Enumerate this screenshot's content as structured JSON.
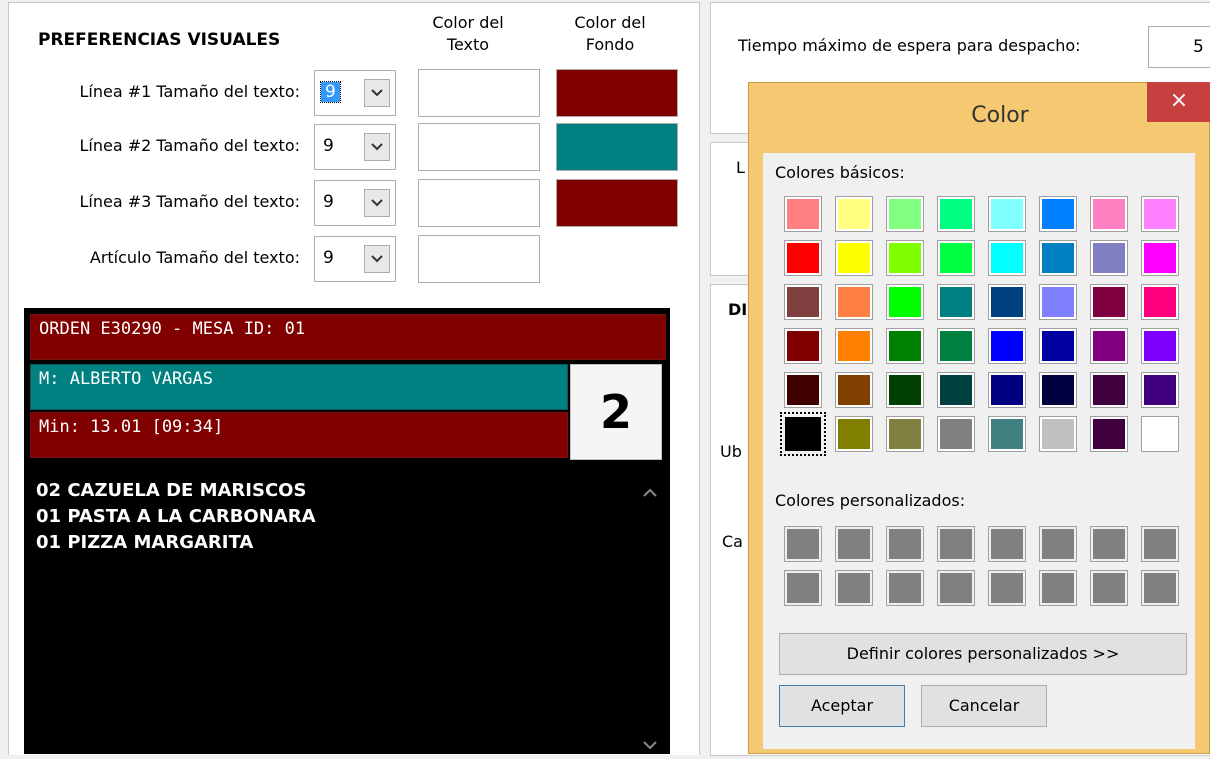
{
  "visual_prefs": {
    "title": "PREFERENCIAS VISUALES",
    "col_text_color": [
      "Color del",
      "Texto"
    ],
    "col_bg_color": [
      "Color del",
      "Fondo"
    ],
    "rows": [
      {
        "label": "Línea #1 Tamaño del texto:",
        "size": "9",
        "text_color": "#ffffff",
        "bg_color": "#800000"
      },
      {
        "label": "Línea #2 Tamaño del texto:",
        "size": "9",
        "text_color": "#ffffff",
        "bg_color": "#008080"
      },
      {
        "label": "Línea #3 Tamaño del texto:",
        "size": "9",
        "text_color": "#ffffff",
        "bg_color": "#800000"
      },
      {
        "label": "Artículo Tamaño del texto:",
        "size": "9",
        "text_color": "#ffffff",
        "bg_color": null
      }
    ]
  },
  "preview": {
    "line1": "ORDEN E30290 - MESA ID: 01",
    "line2": "M: ALBERTO VARGAS",
    "line3": "Min: 13.01 [09:34]",
    "number": "2",
    "items": [
      "02 CAZUELA DE MARISCOS",
      "01 PASTA A LA CARBONARA",
      "01 PIZZA MARGARITA"
    ]
  },
  "right": {
    "max_wait_label": "Tiempo máximo de espera para despacho:",
    "max_wait_value": "5",
    "partial_labels": [
      "L",
      "DI",
      "Ub",
      "Ca"
    ]
  },
  "color_dialog": {
    "title": "Color",
    "close": "×",
    "basic_label": "Colores básicos:",
    "custom_label": "Colores personalizados:",
    "define_button": "Definir colores personalizados >>",
    "ok_button": "Aceptar",
    "cancel_button": "Cancelar",
    "basic_colors": [
      [
        "#ff8080",
        "#ffff80",
        "#80ff80",
        "#00ff80",
        "#80ffff",
        "#0080ff",
        "#ff80c0",
        "#ff80ff"
      ],
      [
        "#ff0000",
        "#ffff00",
        "#80ff00",
        "#00ff40",
        "#00ffff",
        "#0080c0",
        "#8080c0",
        "#ff00ff"
      ],
      [
        "#804040",
        "#ff8040",
        "#00ff00",
        "#008080",
        "#004080",
        "#8080ff",
        "#800040",
        "#ff0080"
      ],
      [
        "#800000",
        "#ff8000",
        "#008000",
        "#008040",
        "#0000ff",
        "#0000a0",
        "#800080",
        "#8000ff"
      ],
      [
        "#400000",
        "#804000",
        "#004000",
        "#004040",
        "#000080",
        "#000040",
        "#400040",
        "#400080"
      ],
      [
        "#000000",
        "#808000",
        "#808040",
        "#808080",
        "#408080",
        "#c0c0c0",
        "#400040",
        "#ffffff"
      ]
    ],
    "selected_color": "#000000",
    "custom_colors_fill": "#808080"
  }
}
